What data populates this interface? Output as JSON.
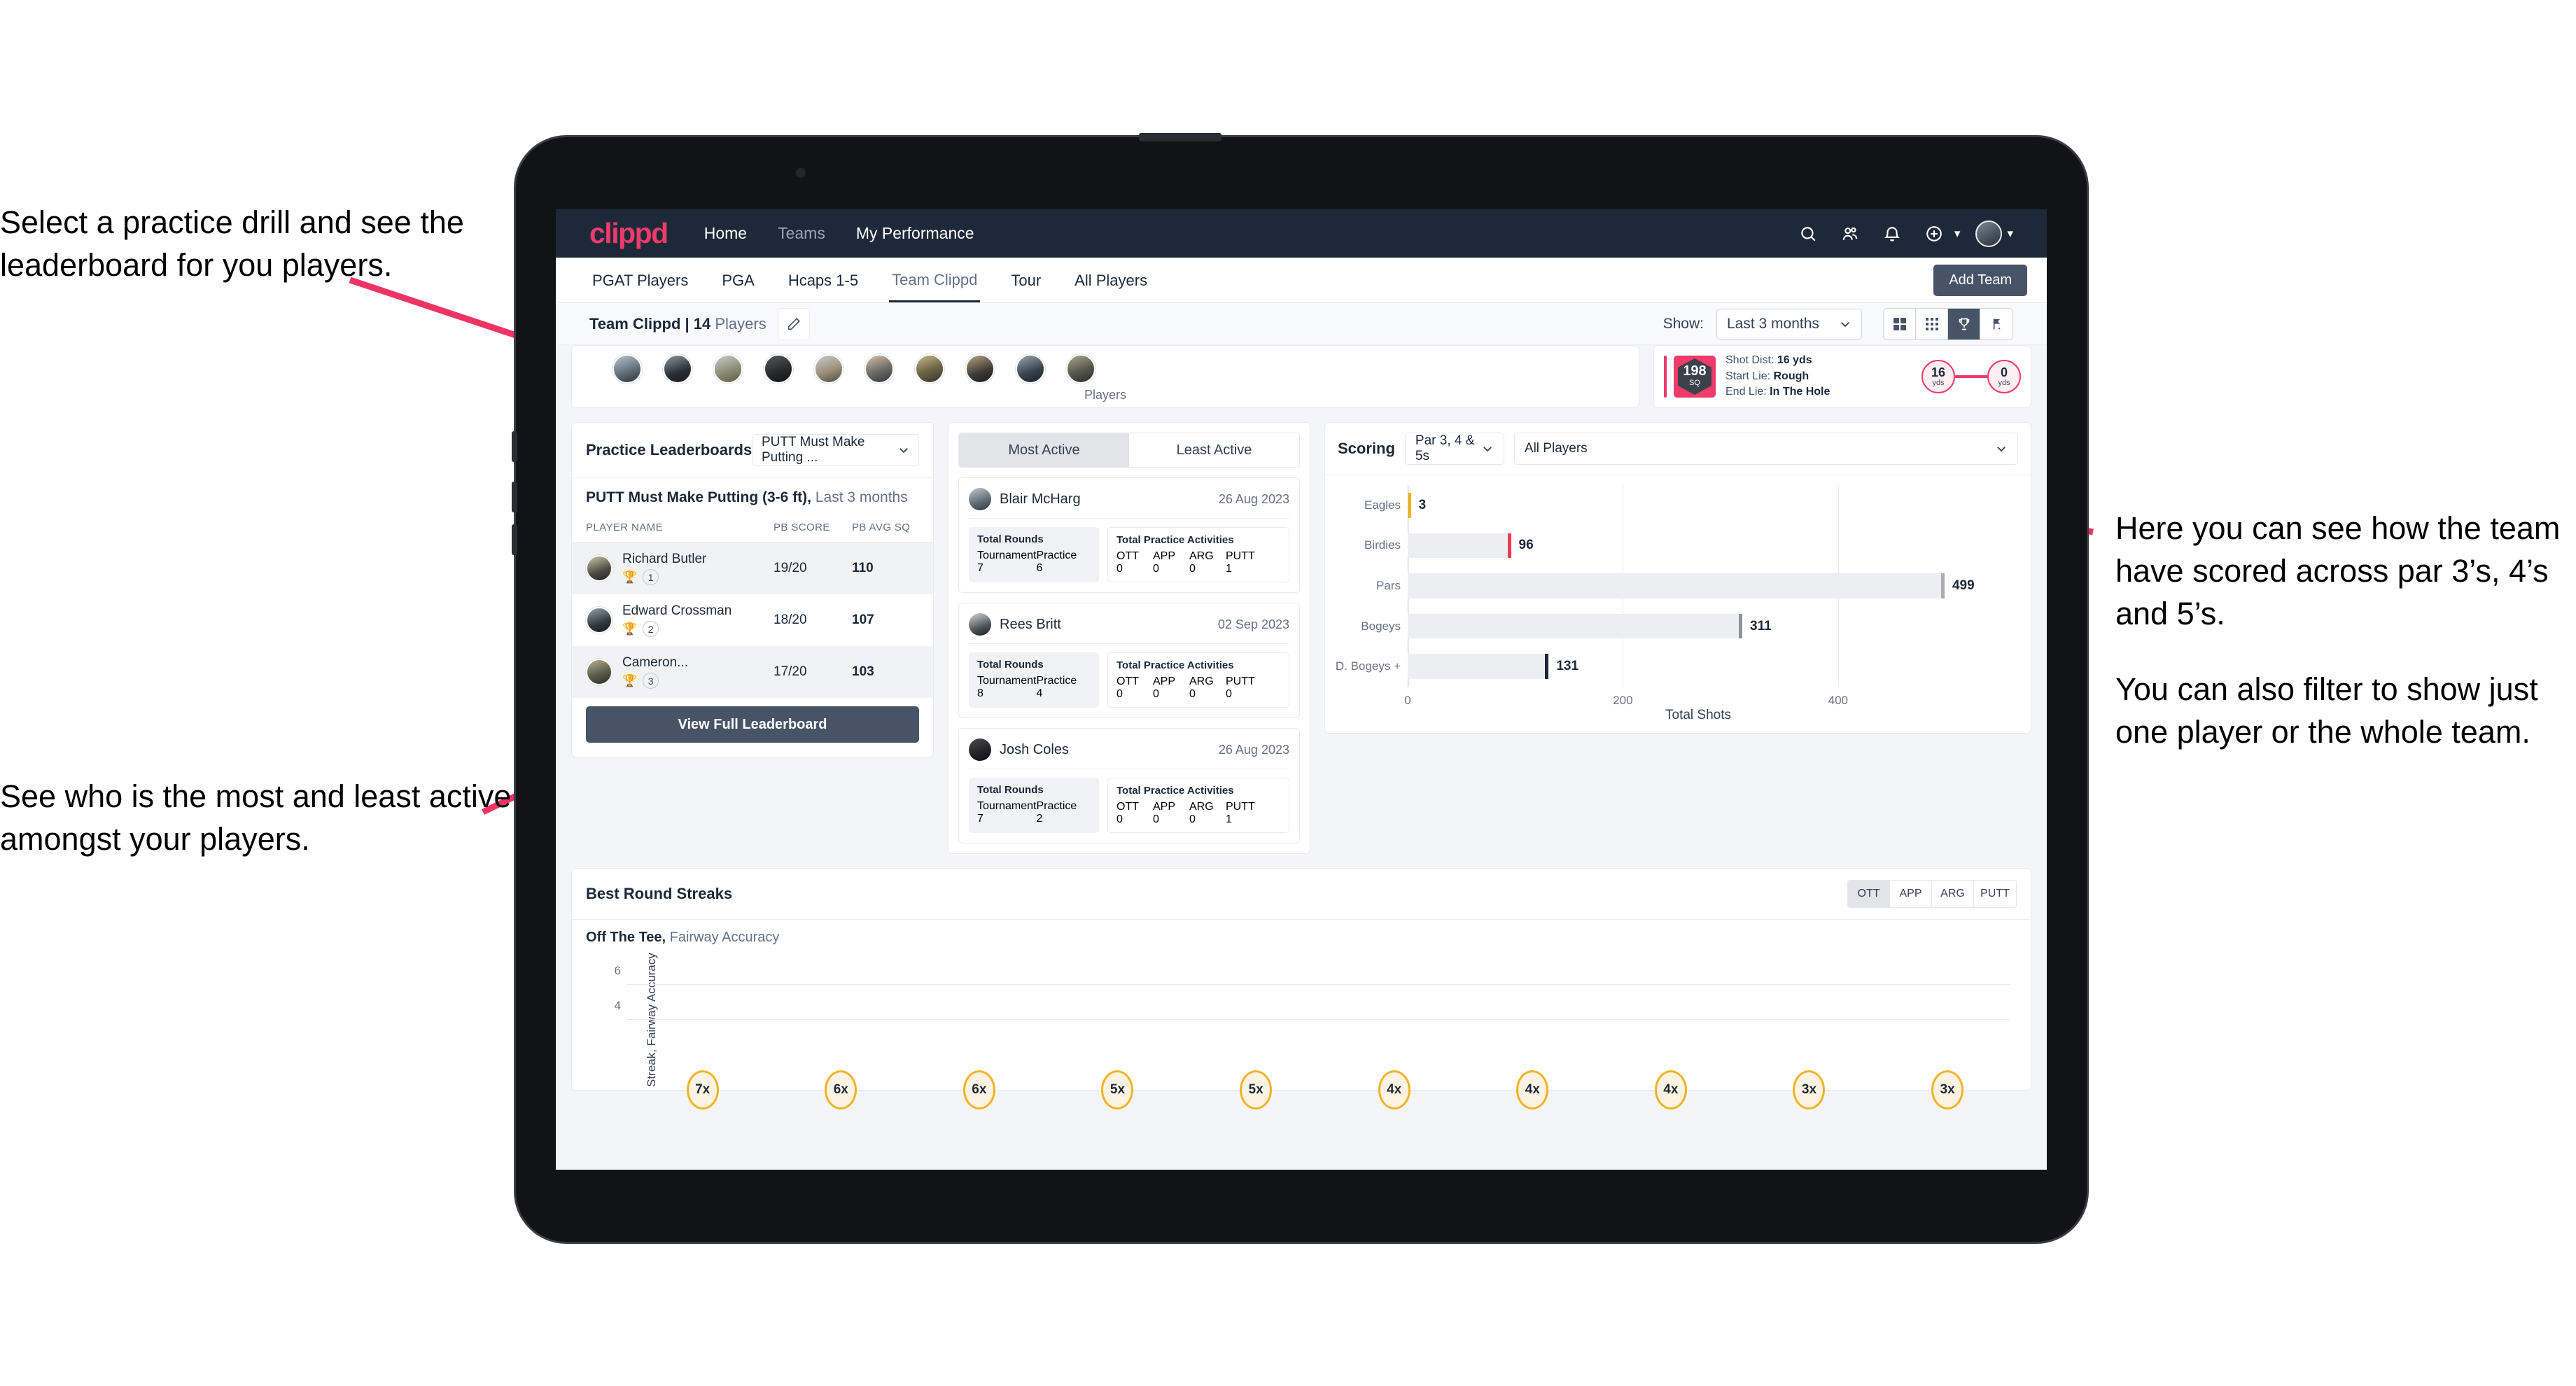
{
  "annotations": {
    "left_top": "Select a practice drill and see the leaderboard for you players.",
    "left_bottom": "See who is the most and least active amongst your players.",
    "right_1": "Here you can see how the team have scored across par 3’s, 4’s and 5’s.",
    "right_2": "You can also filter to show just one player or the whole team.",
    "arrow_color": "#ee3464"
  },
  "app": {
    "logo": "clippd",
    "nav_links": [
      {
        "label": "Home",
        "active": true
      },
      {
        "label": "Teams",
        "active": false
      },
      {
        "label": "My Performance",
        "active": true
      }
    ],
    "nav_icons": [
      "search-icon",
      "people-icon",
      "bell-icon",
      "plus-circle-icon",
      "avatar"
    ],
    "brand_color": "#ee3b6b",
    "nav_bg": "#1d2939"
  },
  "subtabs": {
    "items": [
      {
        "label": "PGAT Players",
        "active": false
      },
      {
        "label": "PGA",
        "active": false
      },
      {
        "label": "Hcaps 1-5",
        "active": false
      },
      {
        "label": "Team Clippd",
        "active": true
      },
      {
        "label": "Tour",
        "active": false
      },
      {
        "label": "All Players",
        "active": false
      }
    ],
    "add_team_label": "Add Team"
  },
  "team_header": {
    "title_bold": "Team Clippd | 14",
    "title_rest": " Players",
    "edit_icon": "pencil-icon",
    "show_label": "Show:",
    "show_value": "Last 3 months",
    "view_modes": [
      {
        "name": "grid-large-view",
        "active": false
      },
      {
        "name": "grid-small-view",
        "active": false
      },
      {
        "name": "trophy-view",
        "active": true
      },
      {
        "name": "flag-view",
        "active": false
      }
    ]
  },
  "players_strip": {
    "label": "Players",
    "count": 10
  },
  "shot_card": {
    "badge_number": "198",
    "badge_unit": "SQ",
    "lines": [
      {
        "label": "Shot Dist:",
        "value": "16 yds"
      },
      {
        "label": "Start Lie:",
        "value": "Rough"
      },
      {
        "label": "End Lie:",
        "value": "In The Hole"
      }
    ],
    "start_circle": {
      "value": "16",
      "unit": "yds"
    },
    "end_circle": {
      "value": "0",
      "unit": "yds"
    }
  },
  "leaderboard": {
    "title": "Practice Leaderboards",
    "drill_select": "PUTT Must Make Putting ...",
    "subtitle_bold": "PUTT Must Make Putting (3-6 ft),",
    "subtitle_rest": " Last 3 months",
    "columns": [
      "PLAYER NAME",
      "PB SCORE",
      "PB AVG SQ"
    ],
    "rows": [
      {
        "name": "Richard Butler",
        "rank": "1",
        "trophy": "gold",
        "score": "19/20",
        "avg": "110"
      },
      {
        "name": "Edward Crossman",
        "rank": "2",
        "trophy": "silver",
        "score": "18/20",
        "avg": "107"
      },
      {
        "name": "Cameron...",
        "rank": "3",
        "trophy": "bronze",
        "score": "17/20",
        "avg": "103"
      }
    ],
    "button_label": "View Full Leaderboard"
  },
  "activity": {
    "tabs": [
      {
        "label": "Most Active",
        "active": true
      },
      {
        "label": "Least Active",
        "active": false
      }
    ],
    "rounds_title": "Total Rounds",
    "rounds_keys": [
      "Tournament",
      "Practice"
    ],
    "acts_title": "Total Practice Activities",
    "acts_keys": [
      "OTT",
      "APP",
      "ARG",
      "PUTT"
    ],
    "items": [
      {
        "name": "Blair McHarg",
        "date": "26 Aug 2023",
        "rounds": [
          "7",
          "6"
        ],
        "acts": [
          "0",
          "0",
          "0",
          "1"
        ]
      },
      {
        "name": "Rees Britt",
        "date": "02 Sep 2023",
        "rounds": [
          "8",
          "4"
        ],
        "acts": [
          "0",
          "0",
          "0",
          "0"
        ]
      },
      {
        "name": "Josh Coles",
        "date": "26 Aug 2023",
        "rounds": [
          "7",
          "2"
        ],
        "acts": [
          "0",
          "0",
          "0",
          "1"
        ]
      }
    ]
  },
  "scoring": {
    "title": "Scoring",
    "par_select": "Par 3, 4 & 5s",
    "player_select": "All Players"
  },
  "streaks": {
    "title": "Best Round Streaks",
    "tabs": [
      {
        "label": "OTT",
        "active": true
      },
      {
        "label": "APP",
        "active": false
      },
      {
        "label": "ARG",
        "active": false
      },
      {
        "label": "PUTT",
        "active": false
      }
    ],
    "subtitle_bold": "Off The Tee,",
    "subtitle_rest": " Fairway Accuracy"
  },
  "chart_data": [
    {
      "type": "bar",
      "orientation": "horizontal",
      "title": "Scoring",
      "categories": [
        "Eagles",
        "Birdies",
        "Pars",
        "Bogeys",
        "D. Bogeys +"
      ],
      "values": [
        3,
        96,
        499,
        311,
        131
      ],
      "cap_colors": [
        "#f0b429",
        "#ef3b4e",
        "#a9aeb5",
        "#8d939b",
        "#1d2939"
      ],
      "bar_color": "#eceef1",
      "xlabel": "Total Shots",
      "ylabel": "",
      "xlim": [
        0,
        540
      ],
      "xticks": [
        0,
        200,
        400
      ],
      "grid": true,
      "legend": "none"
    },
    {
      "type": "lollipop",
      "title": "Best Round Streaks",
      "subtitle": "Off The Tee, Fairway Accuracy",
      "ylabel": "Streak, Fairway Accuracy",
      "values": [
        7,
        6,
        6,
        5,
        5,
        4,
        4,
        4,
        3,
        3
      ],
      "labels": [
        "7x",
        "6x",
        "6x",
        "5x",
        "5x",
        "4x",
        "4x",
        "4x",
        "3x",
        "3x"
      ],
      "yticks": [
        4,
        6
      ],
      "ylim": [
        0,
        8
      ],
      "marker_color": "#f0b429",
      "marker_fill": "#fdf3e2",
      "grid": true,
      "legend": "none"
    }
  ]
}
